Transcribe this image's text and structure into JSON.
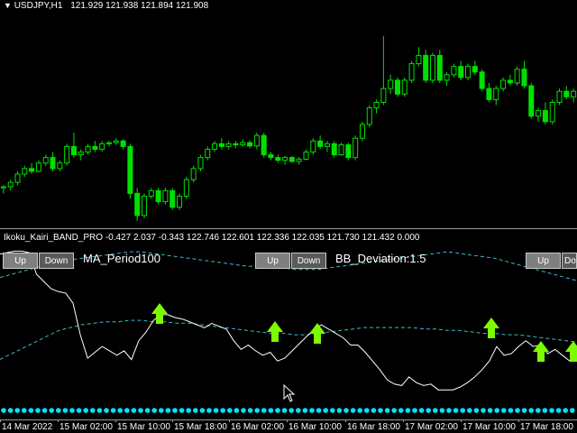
{
  "main_header": {
    "symbol_label": "USDJPY,H1",
    "ohlc": "121.929 121.938 121.894 121.908"
  },
  "indicator_header": "Ikoku_Kairi_BAND_PRO -0.427 2.037 -0.343 122.746 122.601 122.336 122.035 121.730 121.432 0.000",
  "params": {
    "ma_period": "MA_Period100",
    "bb_deviation": "BB_Deviation:1.5"
  },
  "buttons": {
    "up": "Up",
    "down": "Down"
  },
  "x_axis_ticks": [
    "14 Mar 2022",
    "15 Mar 02:00",
    "15 Mar 10:00",
    "15 Mar 18:00",
    "16 Mar 02:00",
    "16 Mar 10:00",
    "16 Mar 18:00",
    "17 Mar 02:00",
    "17 Mar 10:00",
    "17 Mar 18:00"
  ],
  "colors": {
    "candle": "#00e000",
    "price_line": "#ffffff",
    "band": "#3fb9c9",
    "arrow": "#7cfc00",
    "dots": "#00e5ff",
    "separator": "#9a9a9a"
  },
  "chart_data": {
    "type": "candlestick",
    "candles": [
      [
        121.0,
        121.05,
        120.9,
        121.02
      ],
      [
        121.02,
        121.15,
        120.95,
        121.1
      ],
      [
        121.1,
        121.3,
        121.05,
        121.25
      ],
      [
        121.25,
        121.4,
        121.2,
        121.35
      ],
      [
        121.35,
        121.45,
        121.25,
        121.3
      ],
      [
        121.3,
        121.5,
        121.28,
        121.45
      ],
      [
        121.45,
        121.6,
        121.4,
        121.55
      ],
      [
        121.55,
        121.65,
        121.3,
        121.35
      ],
      [
        121.35,
        121.5,
        121.3,
        121.45
      ],
      [
        121.45,
        121.8,
        121.4,
        121.75
      ],
      [
        121.75,
        122.0,
        121.55,
        121.6
      ],
      [
        121.6,
        121.7,
        121.5,
        121.65
      ],
      [
        121.65,
        121.8,
        121.6,
        121.75
      ],
      [
        121.75,
        121.85,
        121.65,
        121.7
      ],
      [
        121.7,
        121.85,
        121.65,
        121.8
      ],
      [
        121.8,
        121.85,
        121.75,
        121.82
      ],
      [
        121.82,
        121.9,
        121.78,
        121.85
      ],
      [
        121.85,
        121.88,
        121.7,
        121.75
      ],
      [
        121.75,
        121.8,
        120.8,
        120.9
      ],
      [
        120.9,
        121.0,
        120.4,
        120.5
      ],
      [
        120.5,
        120.9,
        120.45,
        120.85
      ],
      [
        120.85,
        121.0,
        120.8,
        120.95
      ],
      [
        120.95,
        121.0,
        120.7,
        120.75
      ],
      [
        120.75,
        121.0,
        120.7,
        120.95
      ],
      [
        120.95,
        121.0,
        120.6,
        120.65
      ],
      [
        120.65,
        120.9,
        120.6,
        120.85
      ],
      [
        120.85,
        121.2,
        120.8,
        121.15
      ],
      [
        121.15,
        121.4,
        121.1,
        121.35
      ],
      [
        121.35,
        121.6,
        121.3,
        121.55
      ],
      [
        121.55,
        121.75,
        121.5,
        121.7
      ],
      [
        121.7,
        121.85,
        121.65,
        121.8
      ],
      [
        121.8,
        121.9,
        121.7,
        121.75
      ],
      [
        121.75,
        121.85,
        121.7,
        121.8
      ],
      [
        121.8,
        121.85,
        121.72,
        121.78
      ],
      [
        121.78,
        121.88,
        121.74,
        121.82
      ],
      [
        121.82,
        121.86,
        121.72,
        121.76
      ],
      [
        121.76,
        122.0,
        121.7,
        121.95
      ],
      [
        121.95,
        122.0,
        121.55,
        121.6
      ],
      [
        121.6,
        121.65,
        121.5,
        121.55
      ],
      [
        121.55,
        121.6,
        121.45,
        121.5
      ],
      [
        121.5,
        121.58,
        121.42,
        121.55
      ],
      [
        121.55,
        121.58,
        121.45,
        121.48
      ],
      [
        121.48,
        121.56,
        121.42,
        121.52
      ],
      [
        121.52,
        121.7,
        121.5,
        121.65
      ],
      [
        121.65,
        121.9,
        121.6,
        121.85
      ],
      [
        121.85,
        121.95,
        121.7,
        121.75
      ],
      [
        121.75,
        121.85,
        121.65,
        121.8
      ],
      [
        121.8,
        121.85,
        121.55,
        121.6
      ],
      [
        121.6,
        121.82,
        121.58,
        121.78
      ],
      [
        121.78,
        121.82,
        121.5,
        121.55
      ],
      [
        121.55,
        121.95,
        121.5,
        121.9
      ],
      [
        121.9,
        122.2,
        121.85,
        122.15
      ],
      [
        122.15,
        122.5,
        122.1,
        122.45
      ],
      [
        122.45,
        122.6,
        122.35,
        122.55
      ],
      [
        122.55,
        123.75,
        122.5,
        122.8
      ],
      [
        122.8,
        123.05,
        122.7,
        122.95
      ],
      [
        122.95,
        123.0,
        122.65,
        122.7
      ],
      [
        122.7,
        123.0,
        122.65,
        122.95
      ],
      [
        122.95,
        123.3,
        122.9,
        123.25
      ],
      [
        123.25,
        123.55,
        123.2,
        123.4
      ],
      [
        123.4,
        123.5,
        122.9,
        122.95
      ],
      [
        122.95,
        123.45,
        122.9,
        123.4
      ],
      [
        123.4,
        123.5,
        122.9,
        122.95
      ],
      [
        122.95,
        123.1,
        122.85,
        123.05
      ],
      [
        123.05,
        123.25,
        123.0,
        123.2
      ],
      [
        123.2,
        123.3,
        122.95,
        123.0
      ],
      [
        123.0,
        123.25,
        122.95,
        123.2
      ],
      [
        123.2,
        123.3,
        123.05,
        123.1
      ],
      [
        123.1,
        123.15,
        122.75,
        122.8
      ],
      [
        122.8,
        122.9,
        122.55,
        122.6
      ],
      [
        122.6,
        122.85,
        122.5,
        122.8
      ],
      [
        122.8,
        123.0,
        122.75,
        122.95
      ],
      [
        122.95,
        123.05,
        122.85,
        122.9
      ],
      [
        122.9,
        123.2,
        122.85,
        123.15
      ],
      [
        123.15,
        123.3,
        122.8,
        122.85
      ],
      [
        122.85,
        122.9,
        122.25,
        122.3
      ],
      [
        122.3,
        122.45,
        122.2,
        122.4
      ],
      [
        122.4,
        122.55,
        122.15,
        122.2
      ],
      [
        122.2,
        122.6,
        122.15,
        122.55
      ],
      [
        122.55,
        122.8,
        122.5,
        122.75
      ],
      [
        122.75,
        122.85,
        122.6,
        122.65
      ],
      [
        122.65,
        122.8,
        122.55,
        122.75
      ]
    ],
    "price_line": [
      0.06,
      0.05,
      0.04,
      0.04,
      0.05,
      0.2,
      0.25,
      0.3,
      0.32,
      0.33,
      0.4,
      0.62,
      0.78,
      0.74,
      0.7,
      0.73,
      0.76,
      0.73,
      0.79,
      0.66,
      0.6,
      0.52,
      0.48,
      0.48,
      0.5,
      0.51,
      0.53,
      0.55,
      0.57,
      0.54,
      0.56,
      0.58,
      0.66,
      0.72,
      0.69,
      0.73,
      0.76,
      0.74,
      0.8,
      0.78,
      0.73,
      0.68,
      0.63,
      0.58,
      0.55,
      0.58,
      0.61,
      0.64,
      0.69,
      0.69,
      0.74,
      0.8,
      0.86,
      0.93,
      0.96,
      0.97,
      0.91,
      0.95,
      0.97,
      0.96,
      1.0,
      1.0,
      1.0,
      0.98,
      0.95,
      0.91,
      0.86,
      0.8,
      0.7,
      0.76,
      0.75,
      0.7,
      0.66,
      0.7,
      0.69,
      0.75,
      0.72,
      0.76,
      0.8,
      0.74
    ],
    "band_upper": [
      0.2,
      0.18,
      0.16,
      0.14,
      0.12,
      0.1,
      0.09,
      0.08,
      0.07,
      0.06,
      0.05,
      0.04,
      0.04,
      0.05,
      0.06,
      0.07,
      0.08,
      0.09,
      0.1,
      0.11,
      0.12,
      0.13,
      0.13,
      0.14,
      0.14,
      0.15,
      0.15,
      0.15,
      0.14,
      0.13,
      0.12,
      0.11,
      0.1,
      0.09,
      0.08,
      0.07,
      0.06,
      0.05,
      0.04,
      0.05,
      0.06,
      0.07,
      0.08,
      0.1,
      0.12,
      0.14,
      0.16,
      0.18,
      0.2,
      0.22
    ],
    "band_lower": [
      0.4,
      0.36,
      0.32,
      0.28,
      0.24,
      0.2,
      0.18,
      0.16,
      0.15,
      0.14,
      0.14,
      0.13,
      0.13,
      0.14,
      0.14,
      0.15,
      0.15,
      0.16,
      0.17,
      0.18,
      0.19,
      0.2,
      0.21,
      0.22,
      0.22,
      0.23,
      0.23,
      0.22,
      0.21,
      0.2,
      0.19,
      0.18,
      0.18,
      0.18,
      0.18,
      0.18,
      0.19,
      0.19,
      0.2,
      0.2,
      0.21,
      0.22,
      0.22,
      0.23,
      0.23,
      0.24,
      0.25,
      0.26,
      0.27,
      0.28
    ],
    "arrows": [
      0.28,
      0.48,
      0.55,
      0.85,
      0.94,
      1.0
    ]
  }
}
